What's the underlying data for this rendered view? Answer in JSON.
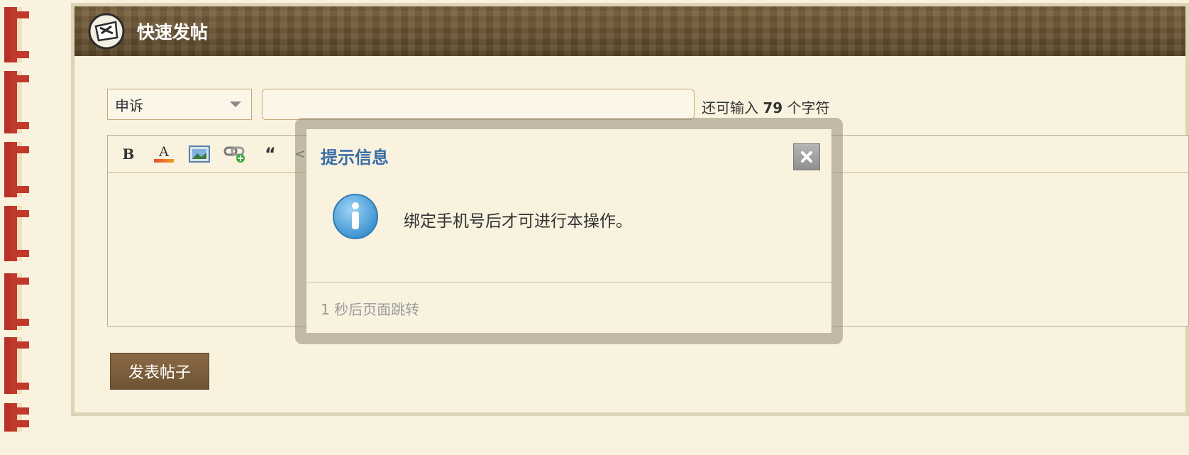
{
  "header": {
    "title": "快速发帖",
    "icon": "forum-post-icon"
  },
  "form": {
    "category": {
      "value": "申诉"
    },
    "title_input": {
      "value": "",
      "placeholder": ""
    },
    "char_hint": {
      "prefix": "还可输入",
      "count": "79",
      "suffix": "个字符"
    },
    "toolbar": {
      "items": [
        {
          "icon": "bold-icon",
          "text": "B"
        },
        {
          "icon": "font-color-icon",
          "text": "A"
        },
        {
          "icon": "image-icon",
          "text": ""
        },
        {
          "icon": "link-icon",
          "text": ""
        },
        {
          "icon": "quote-icon",
          "text": "“"
        },
        {
          "icon": "code-icon",
          "text": "<>"
        }
      ]
    },
    "submit_label": "发表帖子"
  },
  "dialog": {
    "title": "提示信息",
    "message": "绑定手机号后才可进行本操作。",
    "footer": "1 秒后页面跳转",
    "close_icon": "close-icon",
    "info_icon": "info-icon"
  },
  "colors": {
    "accent_title": "#3a6ea5",
    "submit_bg": "#7a5c3a",
    "page_bg": "#f9f2df"
  }
}
